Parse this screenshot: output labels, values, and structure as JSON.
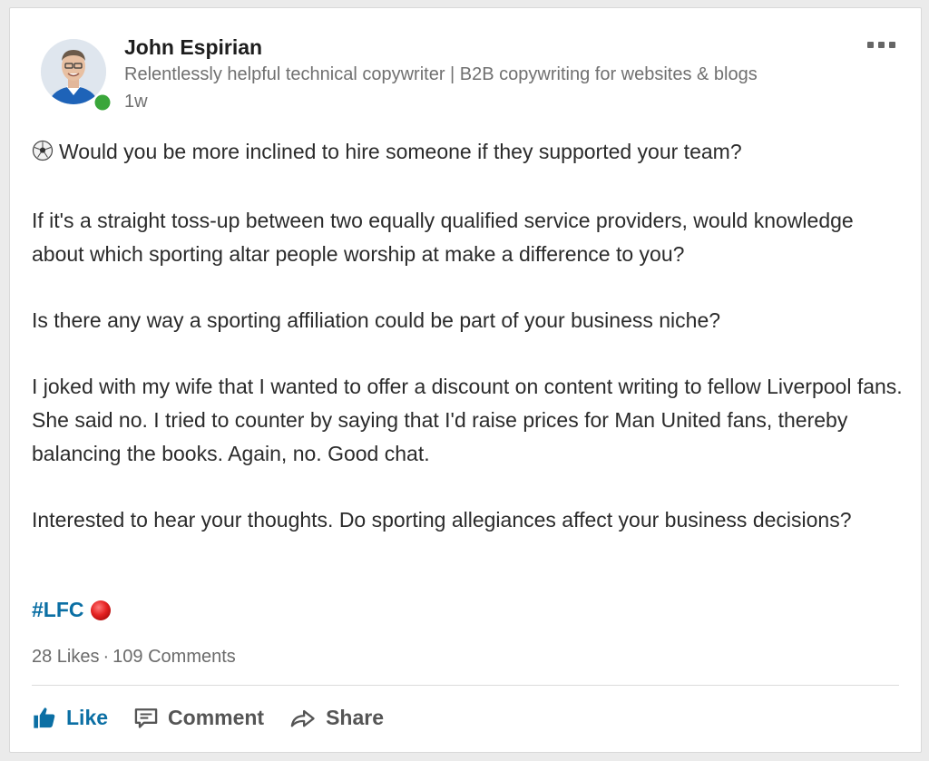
{
  "author": {
    "name": "John Espirian",
    "headline": "Relentlessly helpful technical copywriter | B2B copywriting for websites & blogs",
    "time": "1w",
    "online_status_color": "#3aa63a"
  },
  "post": {
    "paragraphs": [
      "Would you be more inclined to hire someone if they supported your team?",
      "If it's a straight toss-up between two equally qualified service providers, would knowledge about which sporting altar people worship at make a difference to you?",
      "Is there any way a sporting affiliation could be part of your business niche?",
      "I joked with my wife that I wanted to offer a discount on content writing to fellow Liverpool fans. She said no. I tried to counter by saying that I'd raise prices for Man United fans, thereby balancing the books. Again, no. Good chat.",
      "Interested to hear your thoughts. Do sporting allegiances affect your business decisions?"
    ],
    "first_paragraph_icon": "soccer-ball-icon",
    "hashtag": "#LFC",
    "hashtag_icon": "red-circle-icon"
  },
  "social": {
    "likes": "28 Likes",
    "separator": "·",
    "comments": "109 Comments"
  },
  "actions": {
    "like": "Like",
    "comment": "Comment",
    "share": "Share"
  },
  "colors": {
    "link_blue": "#0b6fa4",
    "muted_text": "#707070"
  }
}
